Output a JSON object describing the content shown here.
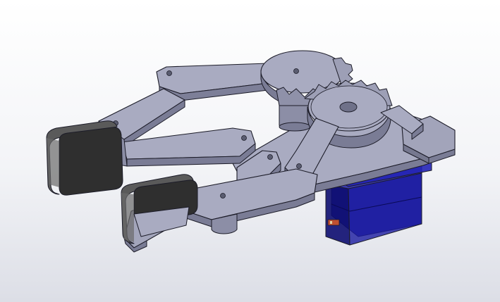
{
  "scene": {
    "subject": "gripper-assembly",
    "colors": {
      "background_top": "#ffffff",
      "background_bottom": "#dcdee6",
      "part_light": "#a9abc1",
      "part_mid": "#8c8ea6",
      "part_dark": "#6f7189",
      "edge": "#1c1c28",
      "pad": "#2f2f2f",
      "pad_side": "#5a5a5a",
      "servo": "#1a1aa0",
      "servo_dark": "#0d0d70",
      "connector": "#c05030"
    }
  }
}
